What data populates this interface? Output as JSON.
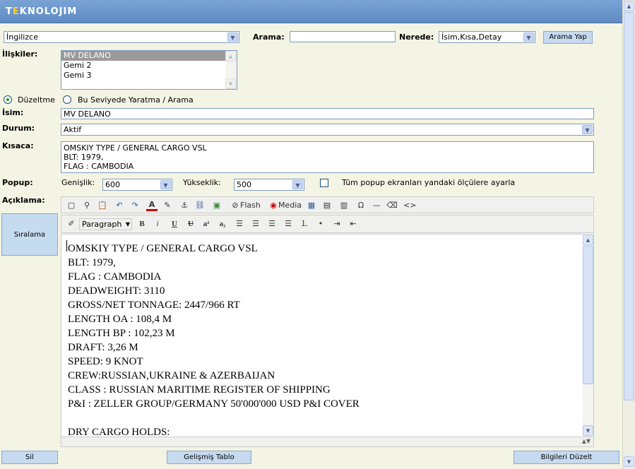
{
  "app": {
    "logo_pre": "T",
    "logo_e": "E",
    "logo_post": "KNOLOJIM"
  },
  "top": {
    "language_value": "İngilizce",
    "search_label": "Arama:",
    "search_value": "",
    "where_label": "Nerede:",
    "where_value": "İsim,Kısa,Detay",
    "search_button": "Arama Yap"
  },
  "relations": {
    "label": "İlişkiler:",
    "items": [
      "MV DELANO",
      "Gemi 2",
      "Gemi 3"
    ]
  },
  "mode": {
    "edit_label": "Düzeltme",
    "create_label": "Bu Seviyede Yaratma / Arama"
  },
  "name": {
    "label": "İsim:",
    "value": "MV DELANO"
  },
  "status": {
    "label": "Durum:",
    "value": "Aktif"
  },
  "short": {
    "label": "Kısaca:",
    "lines": [
      "OMSKIY TYPE / GENERAL CARGO VSL",
      "BLT: 1979,",
      "FLAG : CAMBODIA"
    ]
  },
  "popup": {
    "label": "Popup:",
    "width_label": "Genişlik:",
    "width_value": "600",
    "height_label": "Yükseklik:",
    "height_value": "500",
    "all_label": "Tüm popup ekranları yandaki ölçülere ayarla"
  },
  "description": {
    "label": "Açıklama:"
  },
  "sidebar": {
    "sort_button": "Sıralama"
  },
  "editor": {
    "flash_label": "Flash",
    "media_label": "Media",
    "format_value": "Paragraph",
    "bold": "B",
    "italic": "i",
    "underline": "U",
    "strike": "U",
    "sup": "a²",
    "sub": "a₂",
    "omega": "Ω",
    "code": "<>",
    "content": [
      "OMSKIY TYPE / GENERAL CARGO VSL",
      "BLT: 1979,",
      "FLAG : CAMBODIA",
      "DEADWEIGHT: 3110",
      "GROSS/NET TONNAGE: 2447/966 RT",
      "LENGTH OA : 108,4 M",
      "LENGTH BP : 102,23 M",
      "DRAFT: 3,26 M",
      "SPEED: 9 KNOT",
      "CREW:RUSSIAN,UKRAINE & AZERBAIJAN",
      "CLASS : RUSSIAN MARITIME REGISTER OF SHIPPING",
      "P&I : ZELLER GROUP/GERMANY 50'000'000 USD P&I COVER",
      "",
      "DRY CARGO HOLDS:"
    ]
  },
  "footer": {
    "delete_button": "Sil",
    "advanced_table_button": "Gelişmiş Tablo",
    "update_button": "Bilgileri Düzelt"
  }
}
